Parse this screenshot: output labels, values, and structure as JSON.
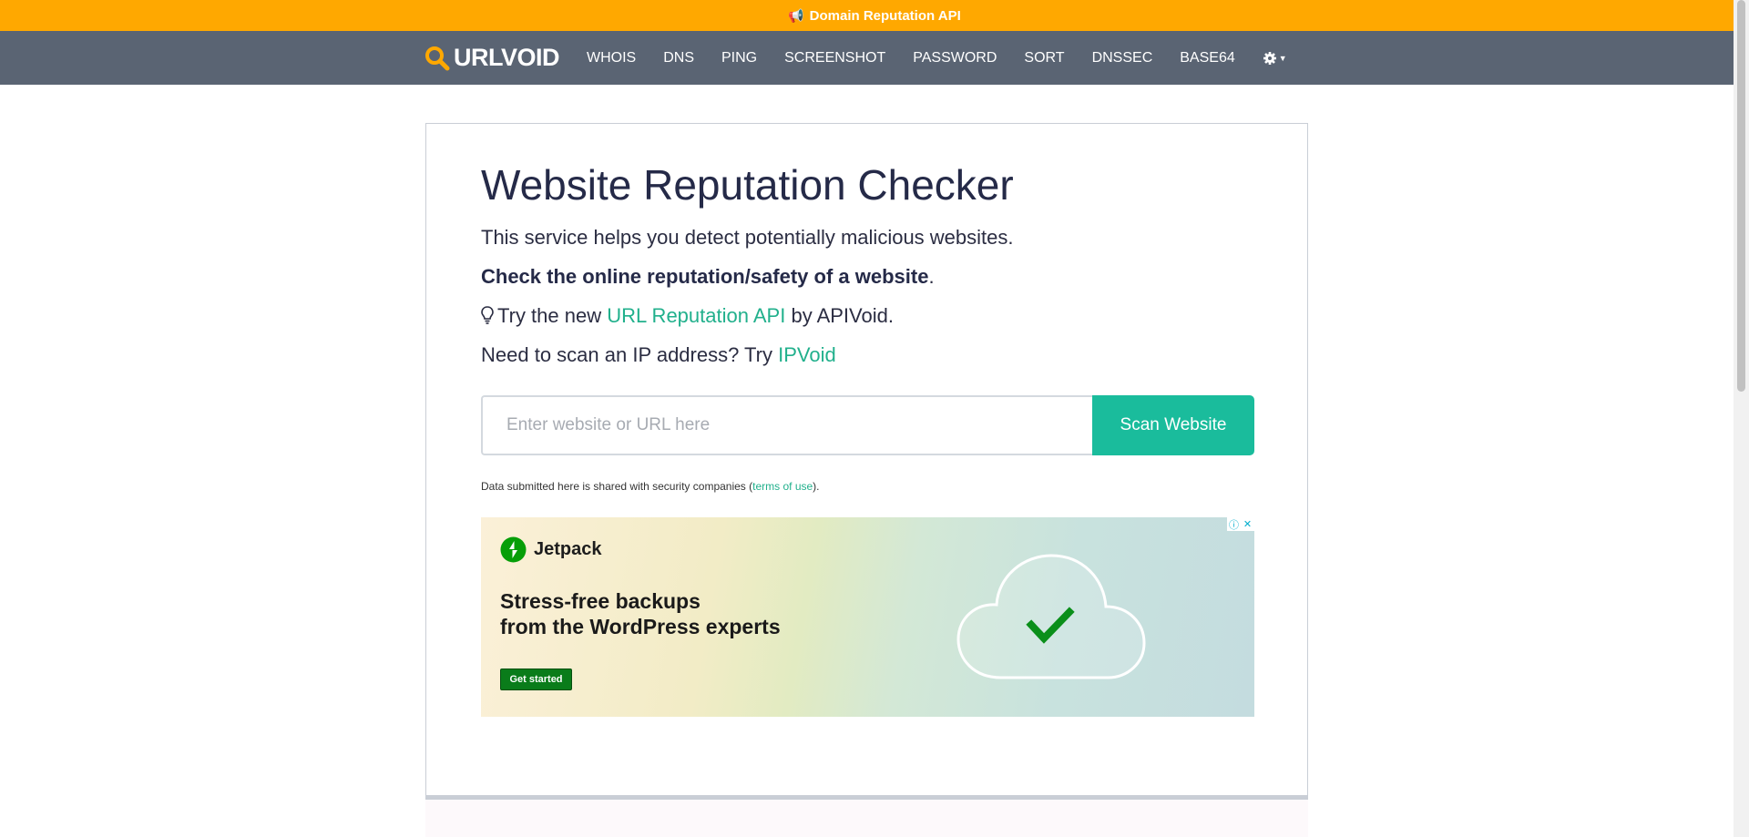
{
  "topbar": {
    "label": "Domain Reputation API"
  },
  "navbar": {
    "brand": "URLVOID",
    "links": [
      "WHOIS",
      "DNS",
      "PING",
      "SCREENSHOT",
      "PASSWORD",
      "SORT",
      "DNSSEC",
      "BASE64"
    ]
  },
  "main": {
    "title": "Website Reputation Checker",
    "subtitle": "This service helps you detect potentially malicious websites.",
    "bold_line": "Check the online reputation/safety of a website",
    "bold_suffix": ".",
    "api_prefix": "Try the new",
    "api_link": "URL Reputation API",
    "api_suffix": "by APIVoid.",
    "ip_prefix": "Need to scan an IP address? Try",
    "ip_link": "IPVoid",
    "scan": {
      "placeholder": "Enter website or URL here",
      "button": "Scan Website"
    },
    "note_prefix": "Data submitted here is shared with security companies (",
    "note_link": "terms of use",
    "note_suffix": ")."
  },
  "ad": {
    "brand": "Jetpack",
    "headline_line1": "Stress-free backups",
    "headline_line2": "from the WordPress experts",
    "cta": "Get started",
    "info_symbol": "ⓘ",
    "close_symbol": "✕"
  },
  "colors": {
    "topbar": "#ffa800",
    "navbar": "#5a6473",
    "accent": "#1abc9c",
    "link": "#21b08c",
    "ad_cta": "#0a7c1a"
  },
  "icons": [
    "megaphone-icon",
    "search-icon",
    "gear-icon",
    "lightbulb-icon",
    "jetpack-logo-icon",
    "cloud-check-icon"
  ]
}
